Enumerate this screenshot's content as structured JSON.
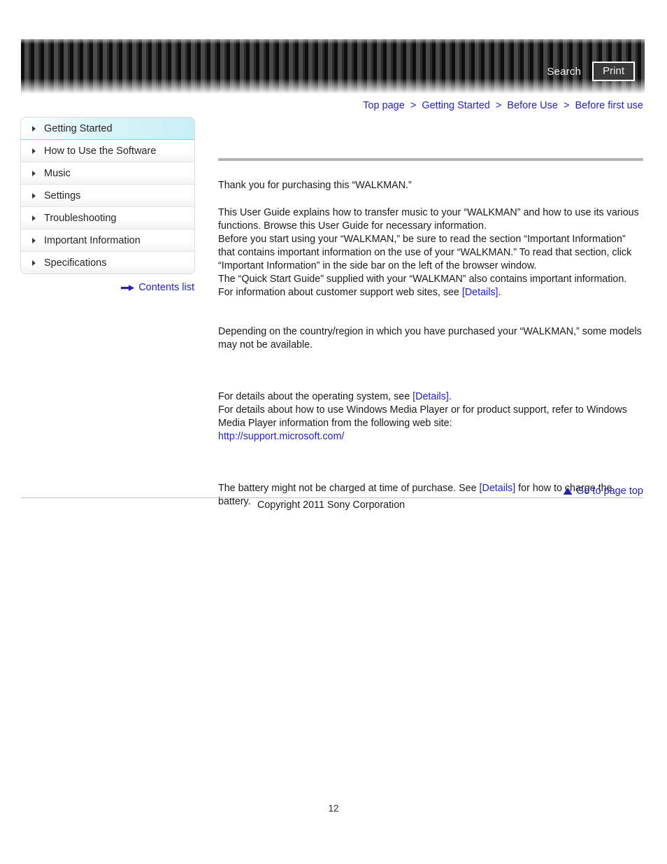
{
  "header": {
    "search_label": "Search",
    "print_label": "Print"
  },
  "breadcrumb": {
    "items": [
      "Top page",
      "Getting Started",
      "Before Use",
      "Before first use"
    ],
    "separator": ">"
  },
  "sidebar": {
    "items": [
      {
        "label": "Getting Started",
        "active": true
      },
      {
        "label": "How to Use the Software",
        "active": false
      },
      {
        "label": "Music",
        "active": false
      },
      {
        "label": "Settings",
        "active": false
      },
      {
        "label": "Troubleshooting",
        "active": false
      },
      {
        "label": "Important Information",
        "active": false
      },
      {
        "label": "Specifications",
        "active": false
      }
    ],
    "contents_list_label": "Contents list",
    "contents_list_icon": "arrow-right-icon"
  },
  "main": {
    "intro": "Thank you for purchasing this “WALKMAN.”",
    "guide_p1": "This User Guide explains how to transfer music to your “WALKMAN” and how to use its various functions. Browse this User Guide for necessary information.",
    "guide_p2": "Before you start using your “WALKMAN,” be sure to read the section “Important Information” that contains important information on the use of your “WALKMAN.” To read that section, click “Important Information” in the side bar on the left of the browser window.",
    "guide_p3": "The “Quick Start Guide” supplied with your “WALKMAN” also contains important information.",
    "support_prefix": "For information about customer support web sites, see ",
    "support_link": "[Details]",
    "support_suffix": ".",
    "region_note": "Depending on the country/region in which you have purchased your “WALKMAN,” some models may not be available.",
    "os_prefix": "For details about the operating system, see ",
    "os_link": "[Details]",
    "os_suffix": ".",
    "wmp_note": "For details about how to use Windows Media Player or for product support, refer to Windows Media Player information from the following web site:",
    "wmp_url": "http://support.microsoft.com/",
    "battery_prefix": "The battery might not be charged at time of purchase. See ",
    "battery_link": "[Details]",
    "battery_suffix": " for how to charge the battery."
  },
  "footer": {
    "page_top_label": "Go to page top",
    "page_top_icon": "triangle-up-icon",
    "copyright": "Copyright 2011 Sony Corporation",
    "page_number": "12"
  },
  "colors": {
    "link": "#2222cc",
    "accent": "#7fd4e4",
    "rule": "#b3b3b3"
  }
}
